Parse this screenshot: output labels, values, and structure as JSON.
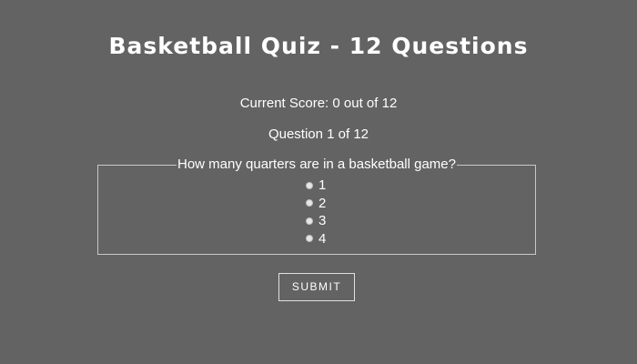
{
  "quiz": {
    "title": "Basketball Quiz - 12 Questions",
    "score_text": "Current Score: 0 out of 12",
    "question_counter": "Question 1 of 12",
    "question": "How many quarters are in a basketball game?",
    "options": [
      {
        "label": "1"
      },
      {
        "label": "2"
      },
      {
        "label": "3"
      },
      {
        "label": "4"
      }
    ],
    "submit_label": "SUBMIT"
  },
  "colors": {
    "background": "#636363",
    "text": "#ffffff",
    "border": "#c8c8c8"
  }
}
